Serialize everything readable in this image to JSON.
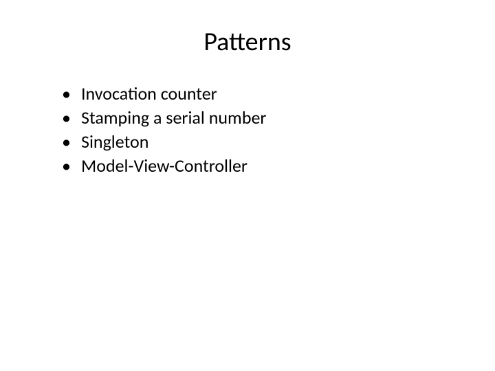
{
  "slide": {
    "title": "Patterns",
    "bullets": [
      "Invocation counter",
      "Stamping a serial number",
      "Singleton",
      "Model-View-Controller"
    ]
  }
}
